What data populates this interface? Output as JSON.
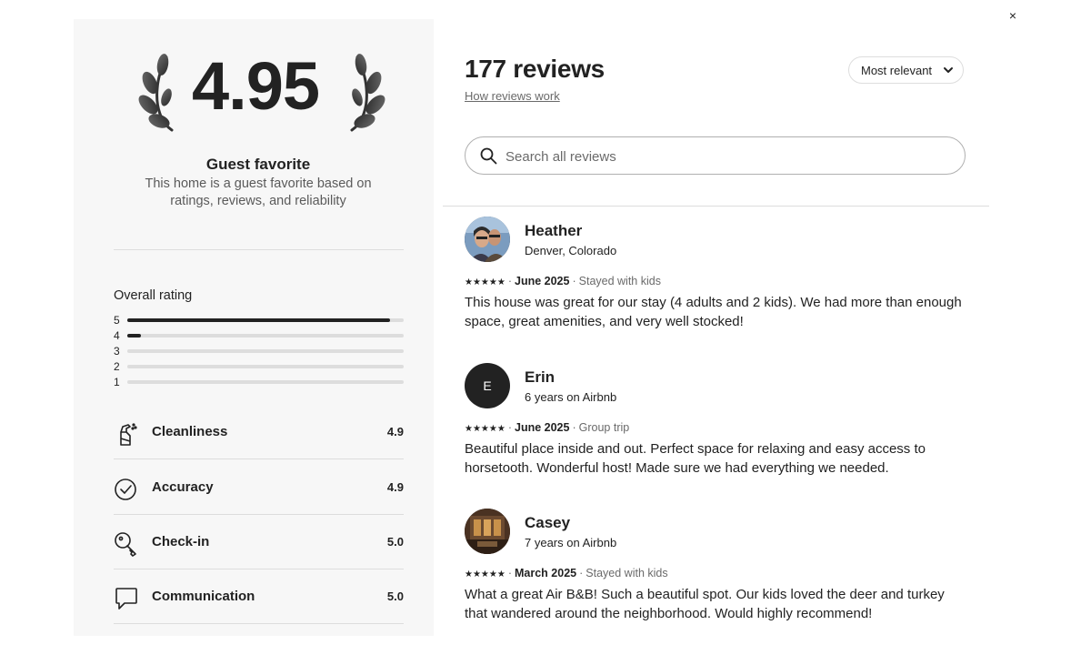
{
  "summary": {
    "rating": "4.95",
    "badge_title": "Guest favorite",
    "badge_desc": "This home is a guest favorite based on ratings, reviews, and reliability",
    "overall_title": "Overall rating",
    "distribution": [
      {
        "label": "5",
        "fraction": 0.95
      },
      {
        "label": "4",
        "fraction": 0.05
      },
      {
        "label": "3",
        "fraction": 0.0
      },
      {
        "label": "2",
        "fraction": 0.0
      },
      {
        "label": "1",
        "fraction": 0.0
      }
    ],
    "categories": [
      {
        "name": "Cleanliness",
        "value": "4.9",
        "icon": "spray-bottle-icon"
      },
      {
        "name": "Accuracy",
        "value": "4.9",
        "icon": "check-circle-icon"
      },
      {
        "name": "Check-in",
        "value": "5.0",
        "icon": "key-icon"
      },
      {
        "name": "Communication",
        "value": "5.0",
        "icon": "chat-bubble-icon"
      }
    ]
  },
  "header": {
    "title": "177 reviews",
    "how_link": "How reviews work",
    "sort_label": "Most relevant",
    "close_icon": "close-icon"
  },
  "search": {
    "placeholder": "Search all reviews"
  },
  "reviews": [
    {
      "name": "Heather",
      "subtitle": "Denver, Colorado",
      "stars": "★★★★★",
      "date": "June 2025",
      "trip": "Stayed with kids",
      "text": "This house was great for our stay (4 adults and 2 kids). We had more than enough space, great amenities, and very well stocked!",
      "avatar_initial": ""
    },
    {
      "name": "Erin",
      "subtitle": "6 years on Airbnb",
      "stars": "★★★★★",
      "date": "June 2025",
      "trip": "Group trip",
      "text": "Beautiful place inside and out. Perfect space for relaxing and easy access to horsetooth. Wonderful host! Made sure we had everything we needed.",
      "avatar_initial": "E"
    },
    {
      "name": "Casey",
      "subtitle": "7 years on Airbnb",
      "stars": "★★★★★",
      "date": "March 2025",
      "trip": "Stayed with kids",
      "text": "What a great Air B&B! Such a beautiful spot. Our kids loved the deer and turkey that wandered around the neighborhood. Would highly recommend!",
      "avatar_initial": ""
    }
  ],
  "colors": {
    "text": "#222222",
    "muted": "#6a6a6a",
    "panel": "#f7f7f7",
    "divider": "#dddddd"
  }
}
